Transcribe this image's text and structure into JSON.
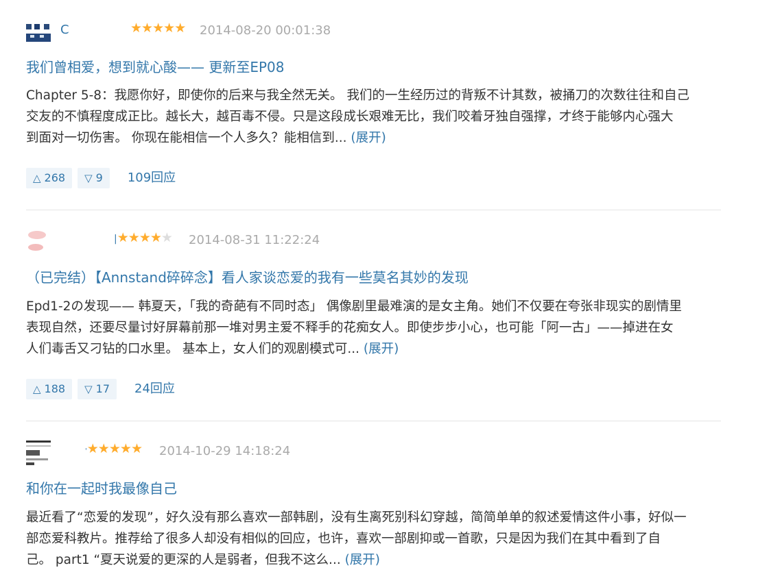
{
  "reviews": [
    {
      "username": "C",
      "rating": 5,
      "stars": [
        "★",
        "★",
        "★",
        "★",
        "★"
      ],
      "date": "2014-08-20 00:01:38",
      "title": "我们曾相爱，想到就心酸—— 更新至EP08",
      "lines": [
        "Chapter 5-8：我愿你好，即使你的后来与我全然无关。 我们的一生经历过的背叛不计其数，被捅刀的次数往往和自己",
        "交友的不慎程度成正比。越长大，越百毒不侵。只是这段成长艰难无比，我们咬着牙独自强撑，才终于能够内心强大",
        "到面对一切伤害。 你现在能相信一个人多久？能相信到..."
      ],
      "expand": "(展开)",
      "useful": "268",
      "useless": "9",
      "replies": "109回应"
    },
    {
      "username": "",
      "rating": 4,
      "stars": [
        "★",
        "★",
        "★",
        "★",
        "★"
      ],
      "date": "2014-08-31 11:22:24",
      "title": "（已完结）【Annstand碎碎念】看人家谈恋爱的我有一些莫名其妙的发现",
      "lines": [
        "Epd1-2の发现—— 韩夏天，「我的奇葩有不同时态」 偶像剧里最难演的是女主角。她们不仅要在夸张非现实的剧情里",
        "表现自然，还要尽量讨好屏幕前那一堆对男主爱不释手的花痴女人。即使步步小心，也可能「阿一古」——掉进在女",
        "人们毒舌又刁钻的口水里。 基本上，女人们的观剧模式可..."
      ],
      "expand": "(展开)",
      "useful": "188",
      "useless": "17",
      "replies": "24回应"
    },
    {
      "username": "",
      "rating": 5,
      "stars": [
        "★",
        "★",
        "★",
        "★",
        "★"
      ],
      "date": "2014-10-29 14:18:24",
      "title": "和你在一起时我最像自己",
      "lines": [
        "最近看了“恋爱的发现”，好久没有那么喜欢一部韩剧，没有生离死别科幻穿越，简简单单的叙述爱情这件小事，好似一",
        "部恋爱科教片。推荐给了很多人却没有相似的回应，也许，喜欢一部剧抑或一首歌，只是因为我们在其中看到了自",
        "己。 part1 “夏天说爱的更深的人是弱者，但我不这么..."
      ],
      "expand": "(展开)"
    }
  ],
  "icons": {
    "up": "△",
    "down": "▽"
  },
  "colors": {
    "link": "#3377aa",
    "star": "#ffac2d",
    "vote_bg": "#eef4f9",
    "date": "#aaaaaa"
  }
}
